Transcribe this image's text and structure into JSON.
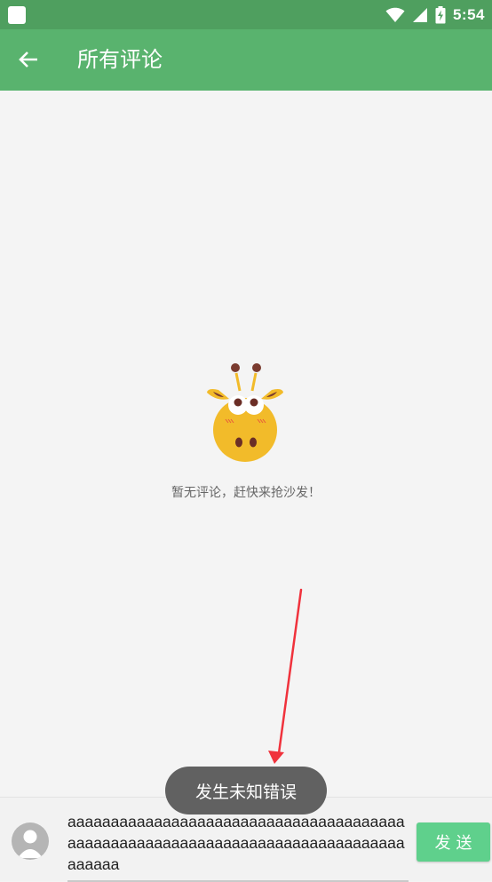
{
  "status_bar": {
    "time": "5:54",
    "icons": [
      "app-notification-icon",
      "wifi-icon",
      "cell-signal-icon",
      "battery-charging-icon"
    ]
  },
  "app_bar": {
    "title": "所有评论",
    "back_icon": "arrow-back-icon"
  },
  "empty_state": {
    "illustration": "giraffe-illustration",
    "message": "暂无评论，赶快来抢沙发！"
  },
  "toast": {
    "message": "发生未知错误"
  },
  "comment_bar": {
    "avatar": "default-avatar-icon",
    "input_value": "aaaaaaaaaaaaaaaaaaaaaaaaaaaaaaaaaaaaaaaaaaaaaaaaaaaaaaaaaaaaaaaaaaaaaaaaaaaaaaaaaaaa",
    "send_label": "发送"
  },
  "colors": {
    "status_bar": "#4f9f5f",
    "app_bar": "#59b36e",
    "send_button": "#5fd08c",
    "toast": "#616161",
    "annotation_arrow": "#f0323c"
  }
}
